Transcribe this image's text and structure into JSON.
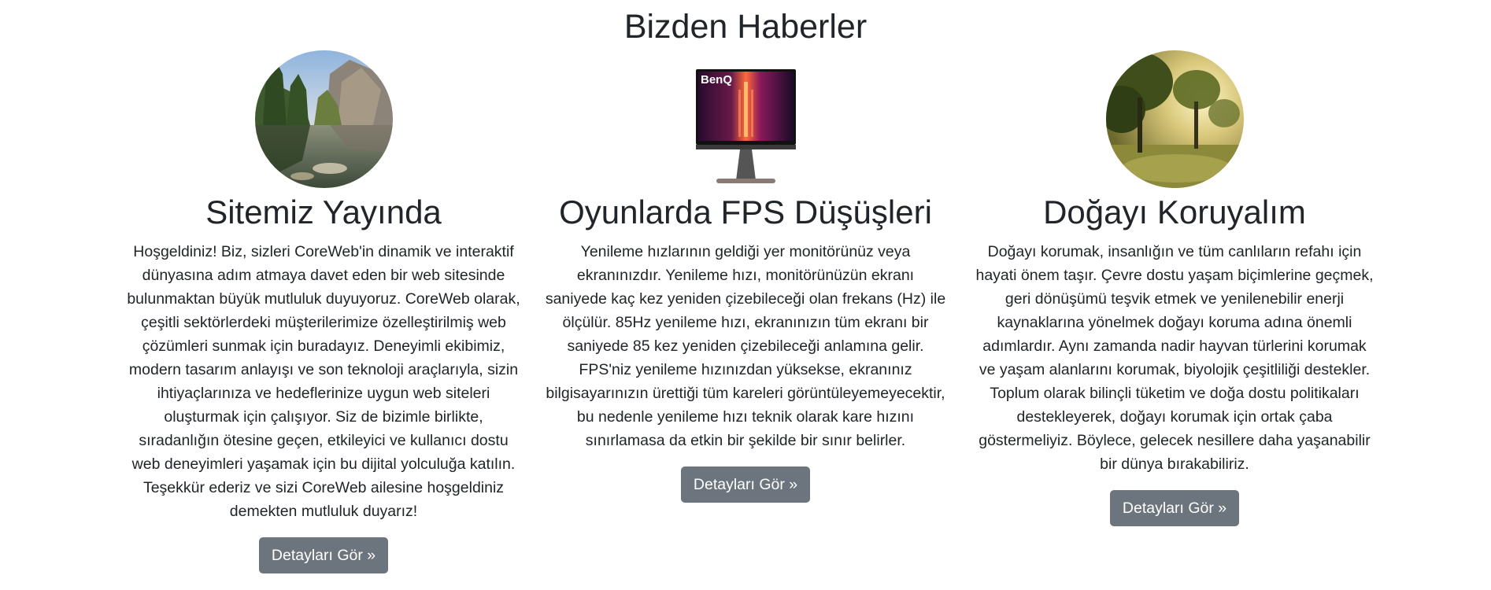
{
  "section": {
    "title": "Bizden Haberler"
  },
  "cards": [
    {
      "image_icon": "landscape-photo",
      "title": "Sitemiz Yayında",
      "text": "Hoşgeldiniz! Biz, sizleri CoreWeb'in dinamik ve interaktif dünyasına adım atmaya davet eden bir web sitesinde bulunmaktan büyük mutluluk duyuyoruz. CoreWeb olarak, çeşitli sektörlerdeki müşterilerimize özelleştirilmiş web çözümleri sunmak için buradayız. Deneyimli ekibimiz, modern tasarım anlayışı ve son teknoloji araçlarıyla, sizin ihtiyaçlarınıza ve hedeflerinize uygun web siteleri oluşturmak için çalışıyor. Siz de bizimle birlikte, sıradanlığın ötesine geçen, etkileyici ve kullanıcı dostu web deneyimleri yaşamak için bu dijital yolculuğa katılın. Teşekkür ederiz ve sizi CoreWeb ailesine hoşgeldiniz demekten mutluluk duyarız!",
      "button_label": "Detayları Gör »"
    },
    {
      "image_icon": "monitor-photo",
      "brand_text": "BenQ",
      "title": "Oyunlarda FPS Düşüşleri",
      "text": "Yenileme hızlarının geldiği yer monitörünüz veya ekranınızdır. Yenileme hızı, monitörünüzün ekranı saniyede kaç kez yeniden çizebileceği olan frekans (Hz) ile ölçülür. 85Hz yenileme hızı, ekranınızın tüm ekranı bir saniyede 85 kez yeniden çizebileceği anlamına gelir. FPS'niz yenileme hızınızdan yüksekse, ekranınız bilgisayarınızın ürettiği tüm kareleri görüntüleyemeyecektir, bu nedenle yenileme hızı teknik olarak kare hızını sınırlamasa da etkin bir şekilde bir sınır belirler.",
      "button_label": "Detayları Gör »"
    },
    {
      "image_icon": "nature-photo",
      "title": "Doğayı Koruyalım",
      "text": "Doğayı korumak, insanlığın ve tüm canlıların refahı için hayati önem taşır. Çevre dostu yaşam biçimlerine geçmek, geri dönüşümü teşvik etmek ve yenilenebilir enerji kaynaklarına yönelmek doğayı koruma adına önemli adımlardır. Aynı zamanda nadir hayvan türlerini korumak ve yaşam alanlarını korumak, biyolojik çeşitliliği destekler. Toplum olarak bilinçli tüketim ve doğa dostu politikaları destekleyerek, doğayı korumak için ortak çaba göstermeliyiz. Böylece, gelecek nesillere daha yaşanabilir bir dünya bırakabiliriz.",
      "button_label": "Detayları Gör »"
    }
  ],
  "colors": {
    "button_bg": "#6c757d",
    "text": "#212529"
  }
}
